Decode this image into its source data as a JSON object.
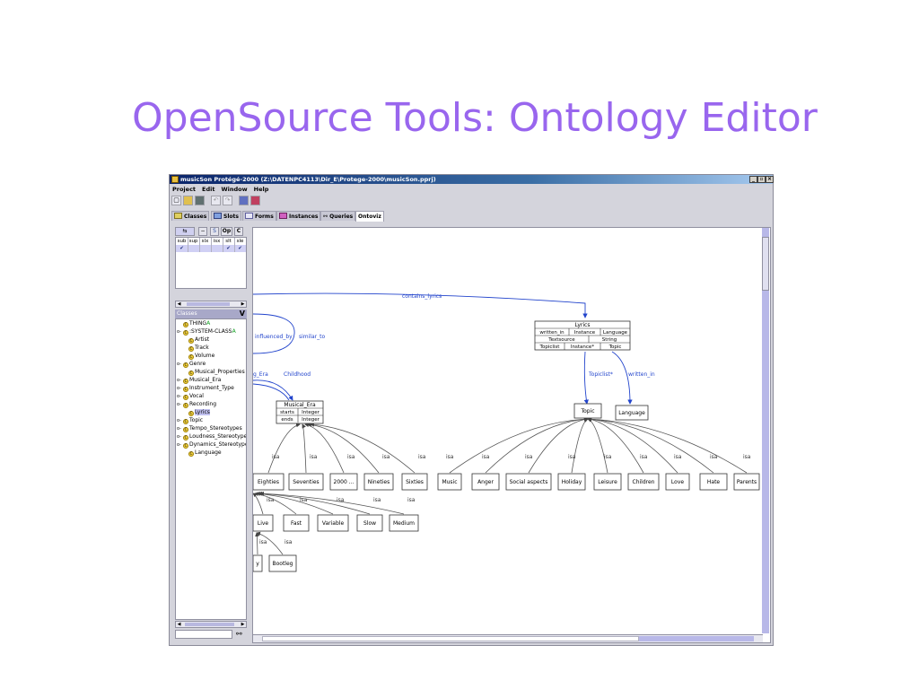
{
  "slide": {
    "title": "OpenSource Tools: Ontology Editor"
  },
  "window": {
    "title": "musicSon  Protégé-2000   (Z:\\DATENPC4113\\Dir_E\\Protege-2000\\musicSon.pprj)",
    "controls": [
      "_",
      "▫",
      "×"
    ]
  },
  "menu": [
    "Project",
    "Edit",
    "Window",
    "Help"
  ],
  "toolbar": {
    "icons": [
      "new-file-icon",
      "open-folder-icon",
      "save-icon",
      "undo-icon",
      "redo-icon",
      "copy-icon",
      "paste-icon"
    ]
  },
  "tabs": [
    {
      "label": "Classes"
    },
    {
      "label": "Slots"
    },
    {
      "label": "Forms"
    },
    {
      "label": "Instances"
    },
    {
      "label": "Queries"
    },
    {
      "label": "Ontoviz"
    }
  ],
  "left_panel": {
    "top_buttons": [
      "⇆",
      "−",
      "S",
      "Op",
      "C"
    ],
    "slot_columns": [
      "sub",
      "sup",
      "slx",
      "isx",
      "slt",
      "sle"
    ],
    "slot_checks": [
      "✔",
      "",
      "",
      "",
      "✔",
      "✔"
    ],
    "classes_header": "Classes",
    "classes_badge": "V"
  },
  "class_tree": [
    {
      "label": "THING",
      "indent": 0,
      "expander": "",
      "marker": "A"
    },
    {
      "label": ":SYSTEM-CLASS",
      "indent": 0,
      "expander": "o-",
      "marker": "A"
    },
    {
      "label": "Artist",
      "indent": 1,
      "expander": "",
      "marker": ""
    },
    {
      "label": "Track",
      "indent": 1,
      "expander": "",
      "marker": ""
    },
    {
      "label": "Volume",
      "indent": 1,
      "expander": "",
      "marker": ""
    },
    {
      "label": "Genre",
      "indent": 0,
      "expander": "o-",
      "marker": ""
    },
    {
      "label": "Musical_Properties",
      "indent": 1,
      "expander": "",
      "marker": ""
    },
    {
      "label": "Musical_Era",
      "indent": 0,
      "expander": "o-",
      "marker": ""
    },
    {
      "label": "Instrument_Type",
      "indent": 0,
      "expander": "o-",
      "marker": ""
    },
    {
      "label": "Vocal",
      "indent": 0,
      "expander": "o-",
      "marker": ""
    },
    {
      "label": "Recording",
      "indent": 0,
      "expander": "o-",
      "marker": ""
    },
    {
      "label": "Lyrics",
      "indent": 1,
      "expander": "",
      "marker": "",
      "selected": true
    },
    {
      "label": "Topic",
      "indent": 0,
      "expander": "o-",
      "marker": ""
    },
    {
      "label": "Tempo_Stereotypes",
      "indent": 0,
      "expander": "o-",
      "marker": ""
    },
    {
      "label": "Loudness_Stereotypes",
      "indent": 0,
      "expander": "o-",
      "marker": ""
    },
    {
      "label": "Dynamics_Stereotypes",
      "indent": 0,
      "expander": "o-",
      "marker": ""
    },
    {
      "label": "Language",
      "indent": 1,
      "expander": "",
      "marker": ""
    }
  ],
  "graph": {
    "edge_labels": {
      "contains_lyrics": "contains_lyrics",
      "influenced_by": "influenced_by",
      "similar_to": "similar_to",
      "era": "g_Era",
      "childhood": "Childhood",
      "topiclist": "Topiclist*",
      "written_in": "written_in",
      "isa": "isa"
    },
    "lyrics_table": {
      "title": "Lyrics",
      "rows": [
        [
          "written_in",
          "Instance",
          "Language"
        ],
        [
          "Textsource",
          "String"
        ],
        [
          "Topiclist",
          "Instance*",
          "Topic"
        ]
      ]
    },
    "era_table": {
      "title": "Musical_Era",
      "rows": [
        [
          "starts",
          "Integer"
        ],
        [
          "ends",
          "Integer"
        ]
      ]
    },
    "era_children": [
      "Eighties",
      "Seventies",
      "2000 ...",
      "Nineties",
      "Sixties"
    ],
    "topic_node": "Topic",
    "language_node": "Language",
    "topic_children": [
      "Music",
      "Anger",
      "Social aspects",
      "Holiday",
      "Leisure",
      "Children",
      "Love",
      "Hate",
      "Parents"
    ],
    "tempo_children": [
      "Live",
      "Fast",
      "Variable",
      "Slow",
      "Medium"
    ],
    "recording_children": [
      "y",
      "Bootleg"
    ]
  }
}
